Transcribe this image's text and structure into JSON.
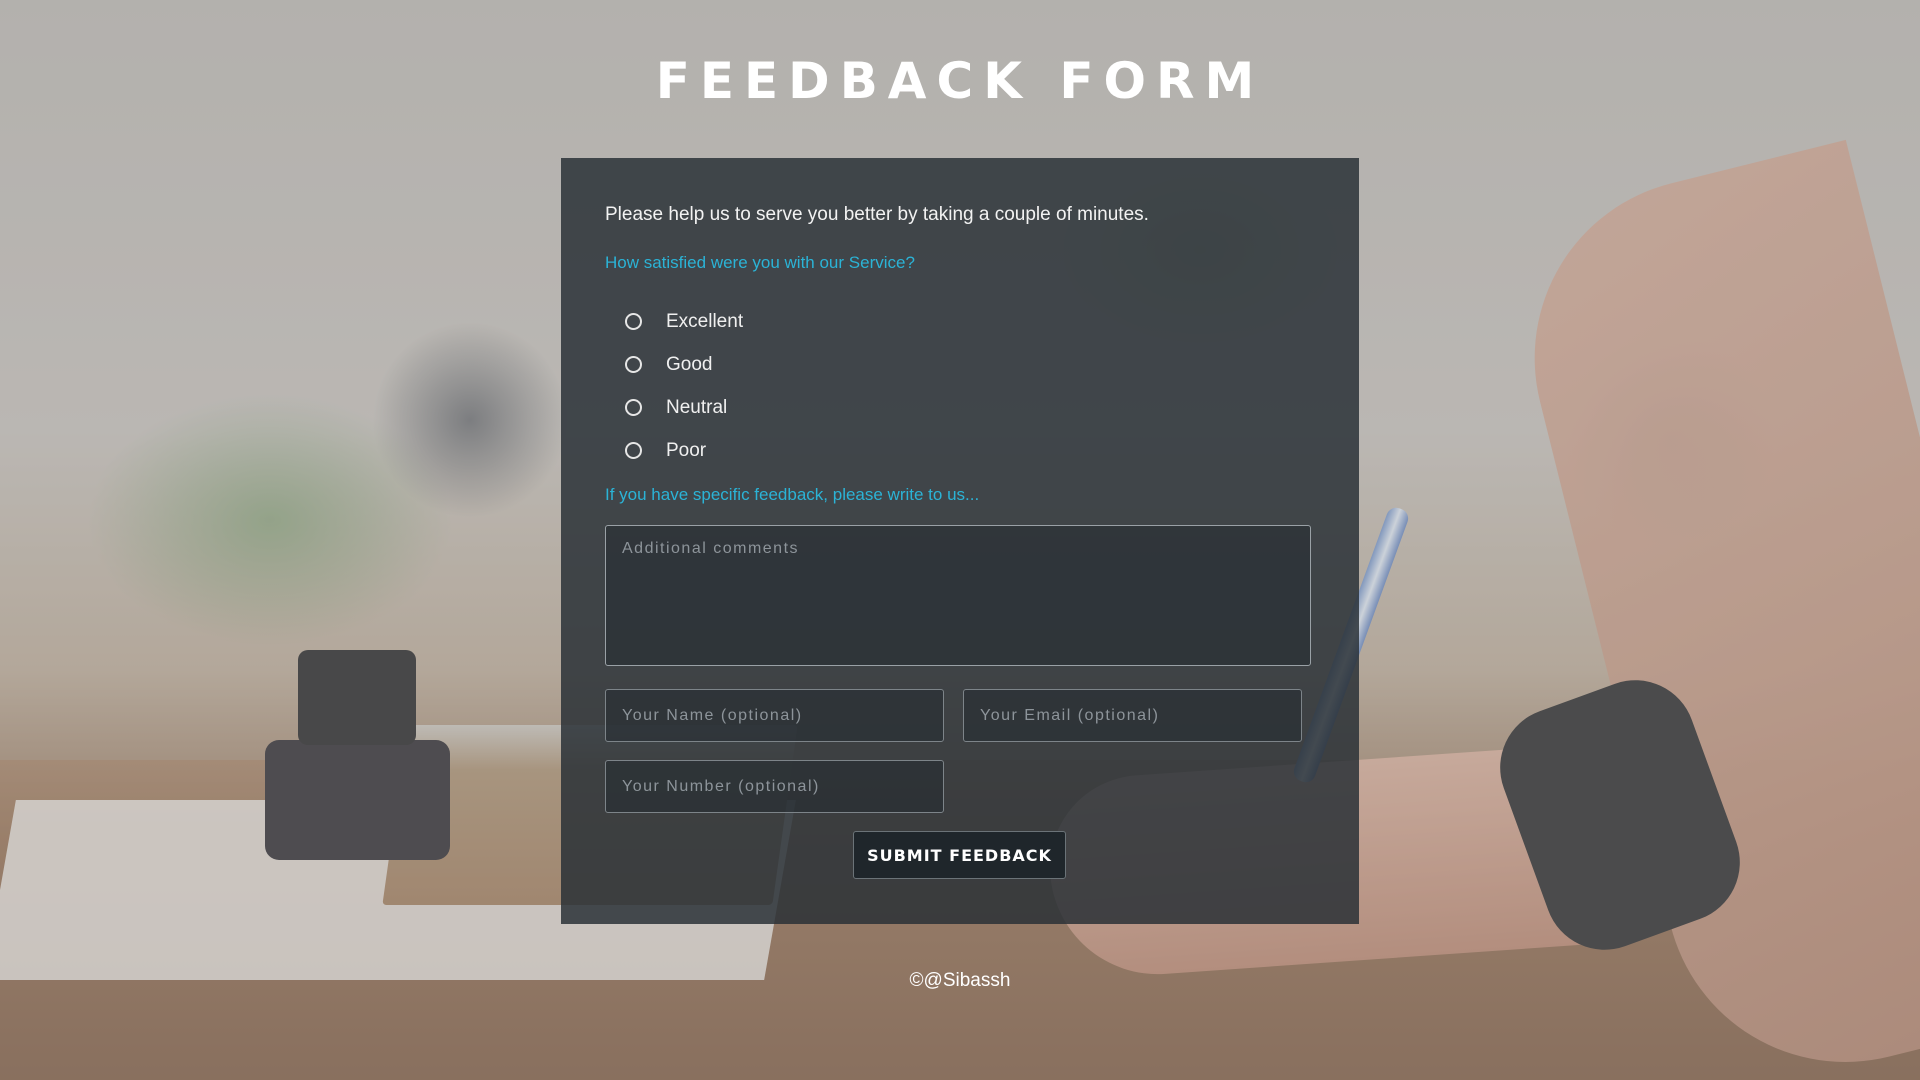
{
  "page": {
    "title": "FEEDBACK FORM",
    "footer": "©@Sibassh"
  },
  "form": {
    "intro": "Please help us to serve you better by taking a couple of minutes.",
    "question": "How satisfied were you with our Service?",
    "options": [
      {
        "label": "Excellent",
        "selected": false
      },
      {
        "label": "Good",
        "selected": false
      },
      {
        "label": "Neutral",
        "selected": false
      },
      {
        "label": "Poor",
        "selected": false
      }
    ],
    "feedback_prompt": "If you have specific feedback, please write to us...",
    "comments": {
      "value": "",
      "placeholder": "Additional comments"
    },
    "name": {
      "value": "",
      "placeholder": "Your Name (optional)"
    },
    "email": {
      "value": "",
      "placeholder": "Your Email (optional)"
    },
    "number": {
      "value": "",
      "placeholder": "Your Number (optional)"
    },
    "submit_label": "SUBMIT FEEDBACK"
  },
  "colors": {
    "accent": "#2bb3d6",
    "panel": "#283036",
    "text": "#ffffff"
  }
}
